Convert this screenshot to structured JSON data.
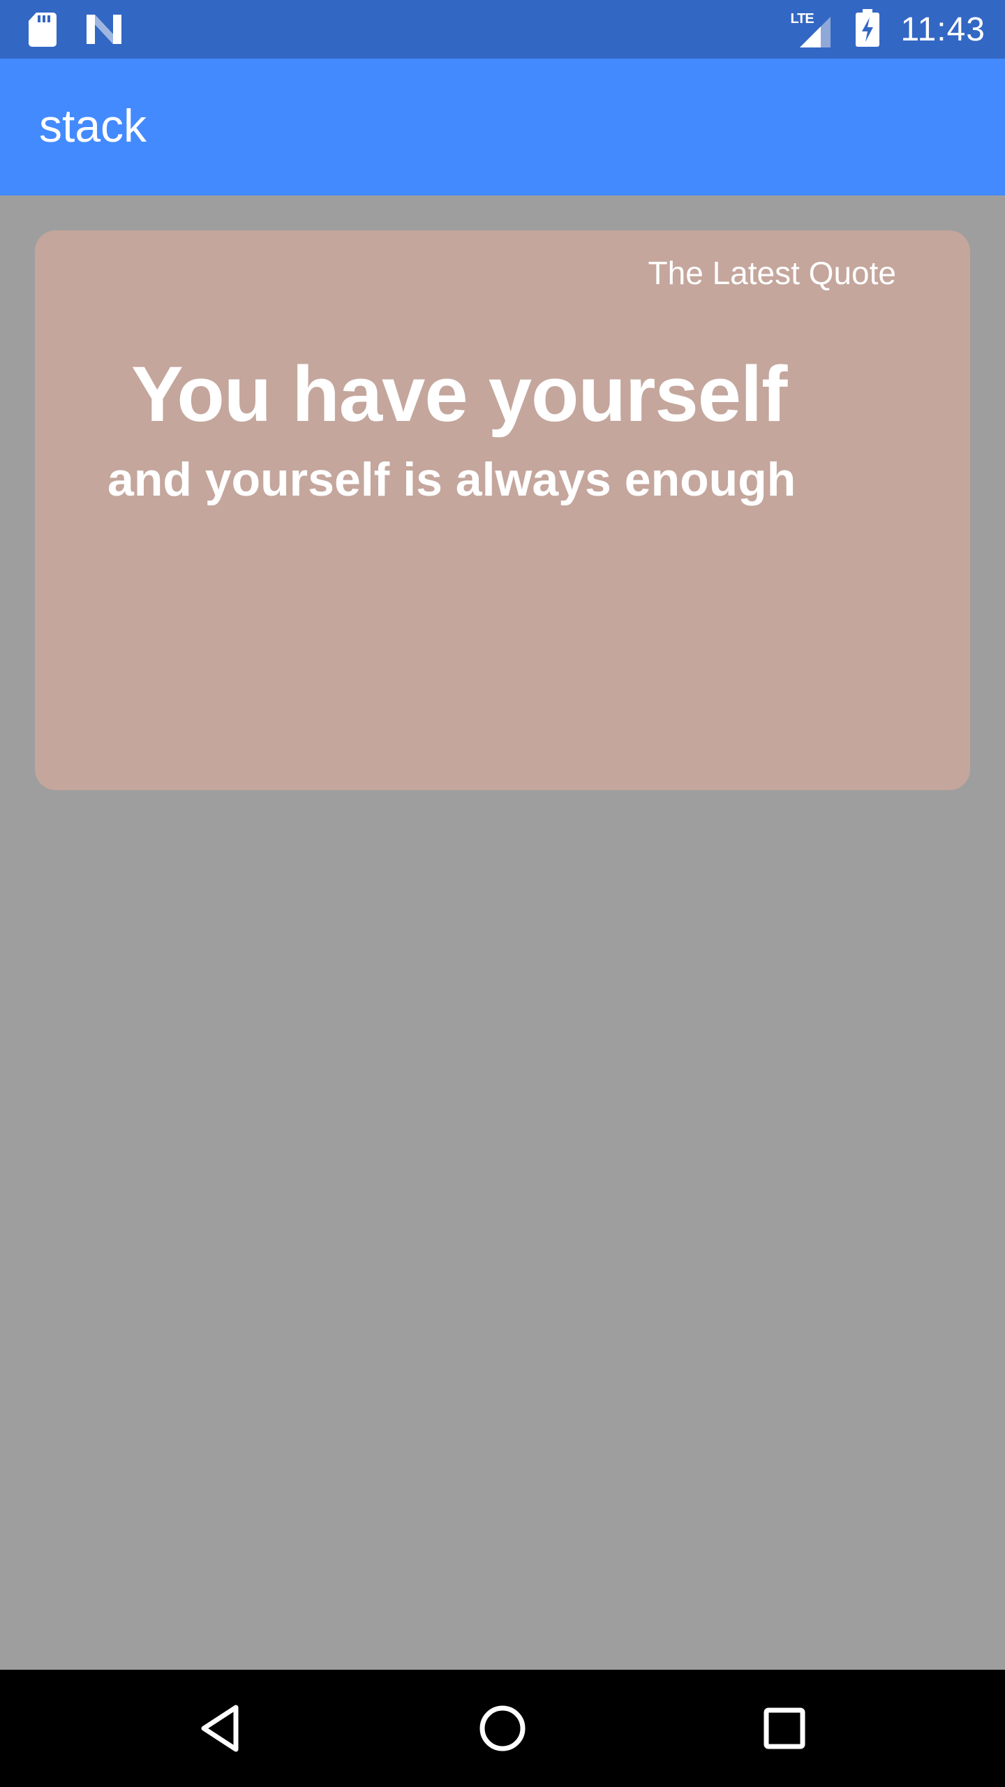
{
  "status_bar": {
    "time": "11:43",
    "network_label": "LTE",
    "icons": [
      "sd-card-icon",
      "n-logo-icon",
      "lte-signal-icon",
      "battery-charging-icon"
    ]
  },
  "app_bar": {
    "title": "stack"
  },
  "quote_card": {
    "header": "The Latest Quote",
    "quote_main": "You have yourself",
    "quote_sub": "and yourself is always enough"
  },
  "nav_bar": {
    "buttons": [
      "back-icon",
      "home-icon",
      "recents-icon"
    ]
  },
  "colors": {
    "status_bar": "#3367c4",
    "app_bar": "#448aff",
    "background": "#9e9e9e",
    "card": "#c4a69c",
    "nav_bar": "#000000"
  }
}
